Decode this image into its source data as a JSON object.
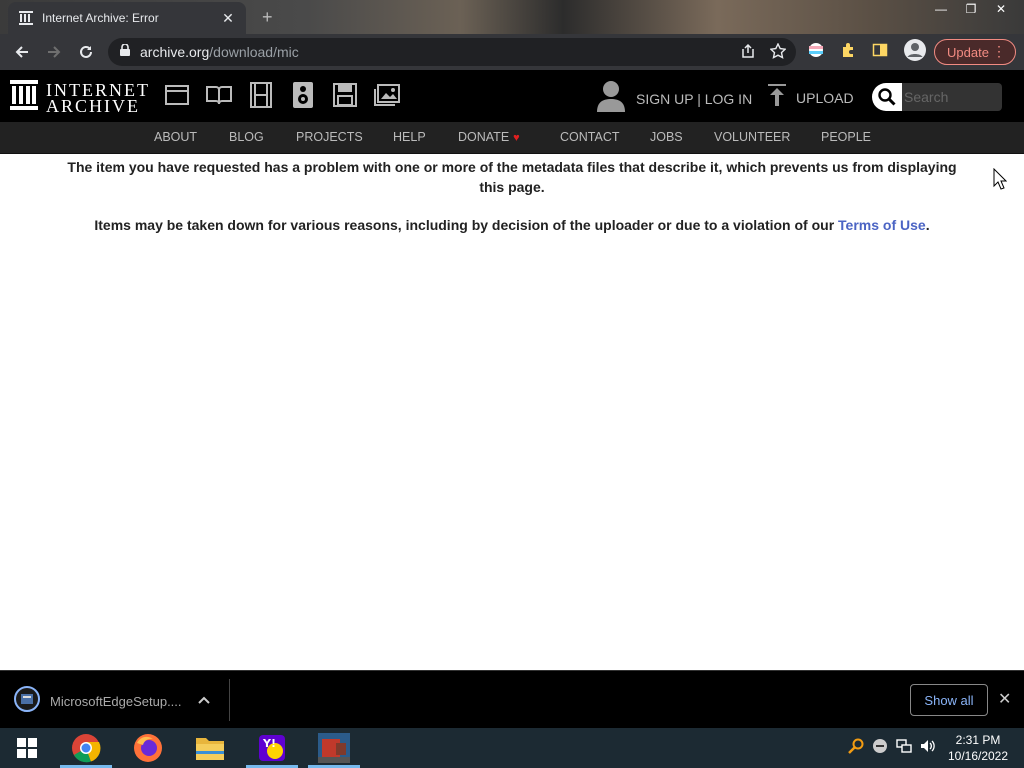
{
  "browser": {
    "tab_title": "Internet Archive: Error",
    "tab_close": "✕",
    "new_tab": "+",
    "url_host": "archive.org",
    "url_path": "/download/mic",
    "update_label": "Update",
    "window_controls": [
      "—",
      "❐",
      "✕"
    ]
  },
  "ia_header": {
    "logo_line1": "INTERNET",
    "logo_line2": "ARCHIVE",
    "media_icons": [
      "web-icon",
      "texts-icon",
      "video-icon",
      "audio-icon",
      "software-icon",
      "images-icon"
    ],
    "account_label": "SIGN UP | LOG IN",
    "upload_label": "UPLOAD",
    "search_placeholder": "Search"
  },
  "nav": {
    "items": [
      "ABOUT",
      "BLOG",
      "PROJECTS",
      "HELP",
      "DONATE",
      "CONTACT",
      "JOBS",
      "VOLUNTEER",
      "PEOPLE"
    ],
    "donate_heart": "♥"
  },
  "content": {
    "message1": "The item you have requested has a problem with one or more of the metadata files that describe it, which prevents us from displaying this page.",
    "message2_prefix": "Items may be taken down for various reasons, including by decision of the uploader or due to a violation of our ",
    "message2_link": "Terms of Use",
    "message2_suffix": "."
  },
  "downloads": {
    "file_name": "MicrosoftEdgeSetup....",
    "chevron": "^",
    "show_all_label": "Show all",
    "close": "✕"
  },
  "taskbar": {
    "apps": [
      "windows-start",
      "chrome",
      "firefox",
      "file-explorer",
      "yahoo-messenger",
      "minecraft"
    ],
    "time": "2:31 PM",
    "date": "10/16/2022"
  },
  "colors": {
    "ia_black": "#000000",
    "ia_nav": "#222222",
    "link_blue": "#4b64c4",
    "update_red": "#f28b82",
    "taskbar": "#1c2a33"
  }
}
